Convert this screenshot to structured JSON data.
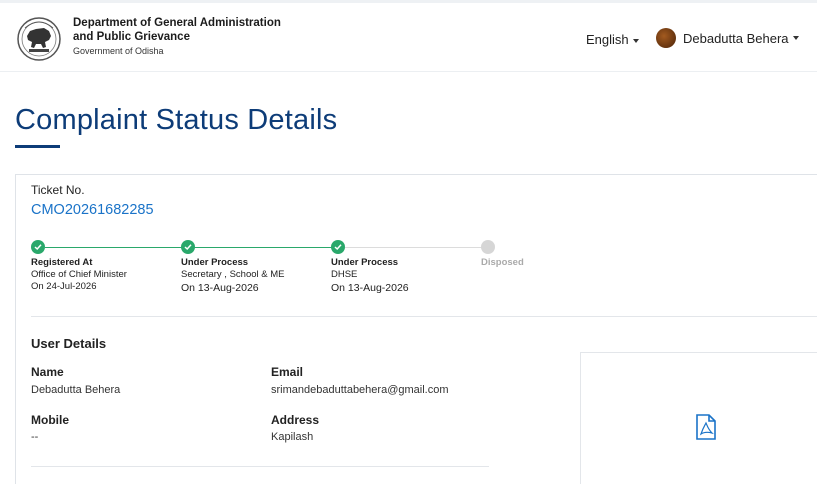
{
  "header": {
    "dept_line1": "Department of General Administration",
    "dept_line2": "and Public Grievance",
    "gov": "Government of Odisha",
    "language": "English",
    "user_name": "Debadutta Behera",
    "logo_icon": "odisha-emblem"
  },
  "page": {
    "title": "Complaint Status Details"
  },
  "ticket": {
    "label": "Ticket No.",
    "number": "CMO20261682285"
  },
  "steps": [
    {
      "title": "Registered At",
      "detail": "Office of Chief Minister",
      "date": "On 24-Jul-2026",
      "status": "done"
    },
    {
      "title": "Under Process",
      "detail": "Secretary , School & ME",
      "date": "On 13-Aug-2026",
      "status": "done"
    },
    {
      "title": "Under Process",
      "detail": "DHSE",
      "date": "On 13-Aug-2026",
      "status": "done"
    },
    {
      "title": "Disposed",
      "detail": "",
      "date": "",
      "status": "pending"
    }
  ],
  "user_details": {
    "title": "User Details",
    "name_label": "Name",
    "name": "Debadutta Behera",
    "email_label": "Email",
    "email": "srimandebaduttabehera@gmail.com",
    "mobile_label": "Mobile",
    "mobile": "--",
    "address_label": "Address",
    "address": "Kapilash"
  },
  "colors": {
    "primary": "#0d3c78",
    "link": "#1a73c8",
    "done": "#2aa86b",
    "pending": "#d6d6d6"
  }
}
